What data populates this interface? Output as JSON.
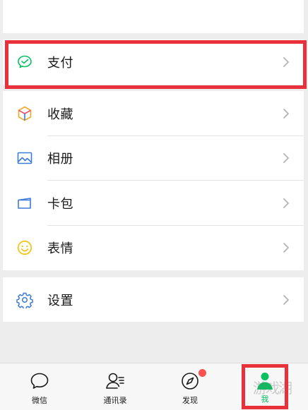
{
  "menu": {
    "pay": {
      "label": "支付",
      "icon": "pay-icon"
    },
    "items": [
      {
        "label": "收藏",
        "icon": "favorites-icon"
      },
      {
        "label": "相册",
        "icon": "album-icon"
      },
      {
        "label": "卡包",
        "icon": "card-wallet-icon"
      },
      {
        "label": "表情",
        "icon": "sticker-icon"
      }
    ],
    "settings": {
      "label": "设置",
      "icon": "settings-icon"
    }
  },
  "tabbar": {
    "tabs": [
      {
        "label": "微信",
        "icon": "chat-bubble-icon",
        "active": false
      },
      {
        "label": "通讯录",
        "icon": "contacts-icon",
        "active": false
      },
      {
        "label": "发现",
        "icon": "compass-icon",
        "active": false,
        "badge": true
      },
      {
        "label": "我",
        "icon": "person-icon",
        "active": true
      }
    ]
  },
  "watermark": "游戏湖",
  "colors": {
    "accent_green": "#07c160",
    "highlight_red": "#e8313b",
    "badge_red": "#fa5151",
    "background": "#ededed"
  }
}
